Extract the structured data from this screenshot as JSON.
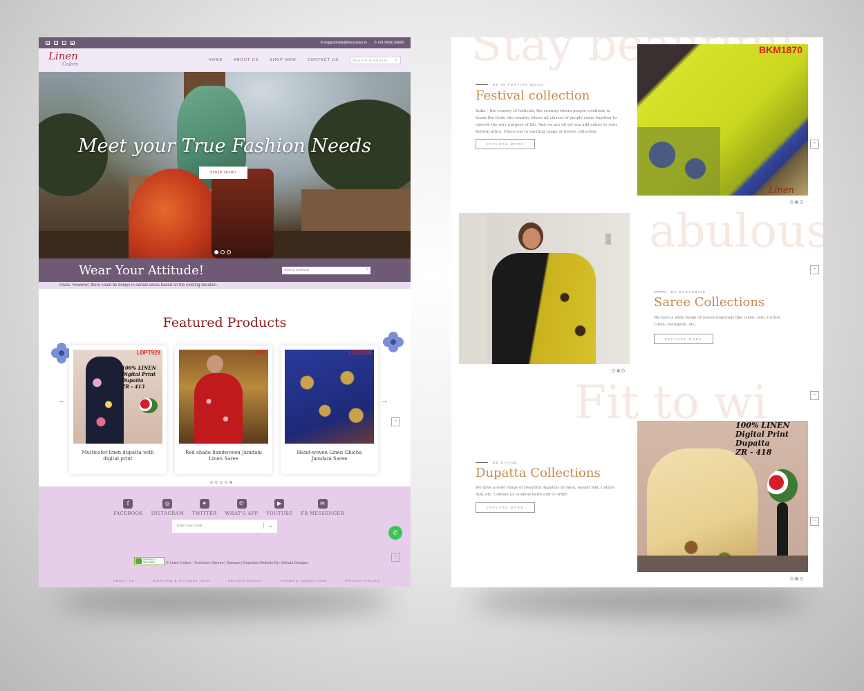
{
  "left": {
    "topbar": {
      "social_icons": [
        "instagram-icon",
        "facebook-icon",
        "twitter-icon",
        "youtube-icon"
      ],
      "email": "happytohelp@linencolors.in",
      "phone": "+91 9606134568"
    },
    "logo": {
      "text": "Linen",
      "sub": "Colors"
    },
    "nav": {
      "items": [
        "HOME",
        "ABOUT US",
        "SHOP NOW",
        "CONTACT US"
      ],
      "search_placeholder": "Search products"
    },
    "hero": {
      "headline": "Meet your True Fashion Needs",
      "button": "SHOP NOW!",
      "slides": 3,
      "active_slide": 1
    },
    "banner": {
      "title": "Wear Your Attitude!",
      "search_placeholder": "Search products"
    },
    "ticker": "ctives. However, there could be delays in certain areas based on the existing situation.",
    "featured": {
      "title": "Featured Products",
      "prev": "←",
      "next": "→",
      "products": [
        {
          "code": "LDPT929",
          "overlay": "100% LINEN\nDigital Print\nDupatta\nZR - 413",
          "name": "Multicolor linen dupatta with digital print"
        },
        {
          "code": "LJ927",
          "overlay": "",
          "name": "Red shade handwoven Jamdani Linen Saree"
        },
        {
          "code": "LGJ1830",
          "overlay": "",
          "name": "Hand-woven Linen Ghicha Jamdani Saree"
        }
      ],
      "pager_count": 5,
      "pager_active": 5
    },
    "footer": {
      "social": [
        {
          "icon": "facebook-icon",
          "glyph": "f",
          "label": "FACEBOOK"
        },
        {
          "icon": "instagram-icon",
          "glyph": "◎",
          "label": "INSTAGRAM"
        },
        {
          "icon": "twitter-icon",
          "glyph": "✦",
          "label": "TWITTER"
        },
        {
          "icon": "whatsapp-icon",
          "glyph": "✆",
          "label": "WHAT'S APP"
        },
        {
          "icon": "youtube-icon",
          "glyph": "▶",
          "label": "YOUTUBE"
        },
        {
          "icon": "messenger-icon",
          "glyph": "✉",
          "label": "FB MESSENGER"
        }
      ],
      "email_placeholder": "Enter your email",
      "submit": "→",
      "badge": "VERIFIED & SECURED",
      "copyright": "© Linen Colors - Exclusive Sarees | Salwars | Dupattas.Website By: Vishala Designs",
      "links": [
        "ABOUT US",
        "SHIPPING & PAYMENT INFO",
        "RETURN POLICY",
        "TERMS & CONDITIONS",
        "PRIVACY POLICY"
      ]
    }
  },
  "right": {
    "ghost_words": [
      "Stay beautiful",
      "abulous",
      "Fit to wi"
    ],
    "sections": [
      {
        "label": "BE IN FESTIVE MOOD",
        "title": "Festival collection",
        "desc": "India – the country of festivals, the country where people celebrate to thank the Gods, the country where all classes of people come together to cherish the very purpose of life. And we are all set you add colors to your festival attire. Check out or exciting range of festive collection",
        "button": "EXPLORE MORE",
        "image_code": "BKM1870",
        "image_watermark": "Linen"
      },
      {
        "label": "BE EXCLUSIVE",
        "title": "Saree Collections",
        "desc": "We have a wide range of sarees materials like Linen, Jute, Cotton Linen, Georgette, etc.",
        "button": "EXPLORE MORE"
      },
      {
        "label": "BE DIVINE",
        "title": "Dupatta Collections",
        "desc": "We have a wide range of beautiful dupattas in linen, Assam Silk, Cotton Silk, etc. Contact us to know more and to order.",
        "button": "EXPLORE MORE",
        "overlay": "100% LINEN\nDigital Print\nDupatta\nZR - 418"
      }
    ]
  },
  "colors": {
    "brand_purple": "#6e5a74",
    "footer_lilac": "#e6cdea",
    "title_red": "#8e1a1a",
    "accent_gold": "#c68a4a"
  }
}
